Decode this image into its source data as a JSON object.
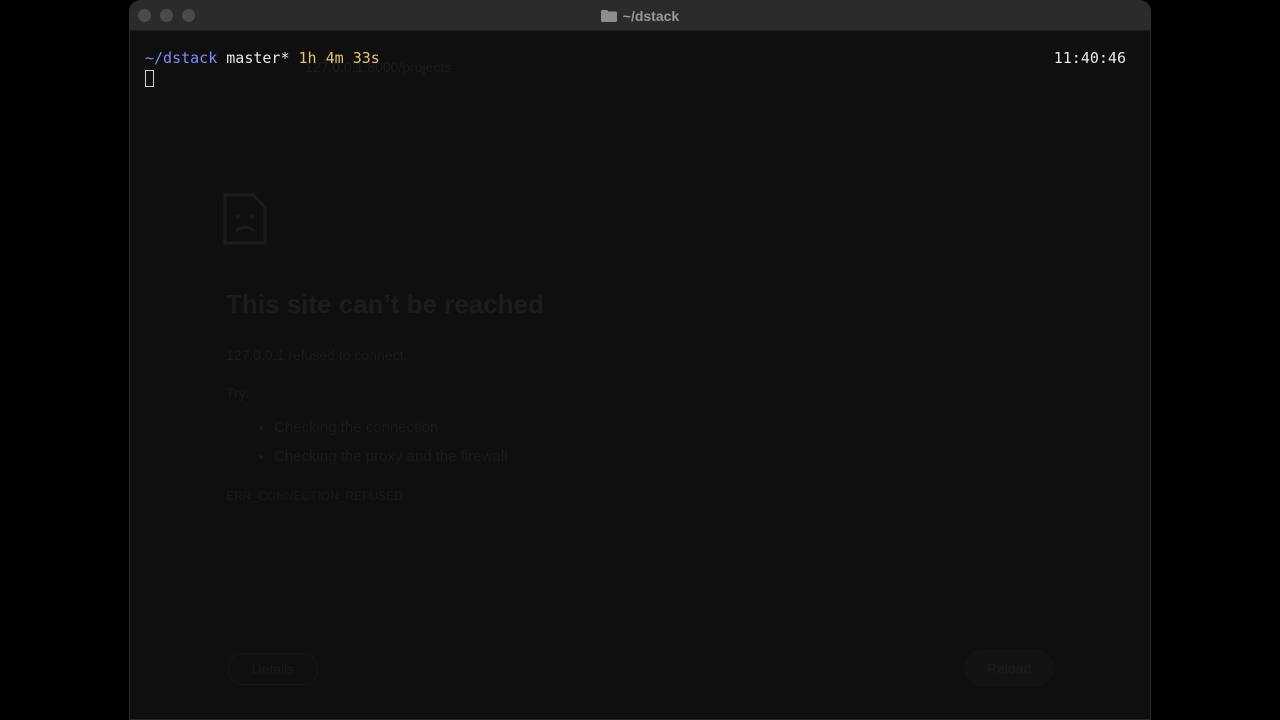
{
  "window": {
    "title": "~/dstack",
    "title_icon": "folder-icon"
  },
  "terminal": {
    "cwd": "~/dstack",
    "branch": "master*",
    "duration": "1h 4m 33s",
    "clock": "11:40:46"
  },
  "ghost_page": {
    "url": "127.0.0.1:8000/projects",
    "heading": "This site can’t be reached",
    "subtitle": "127.0.0.1 refused to connect.",
    "try_label": "Try:",
    "suggestions": [
      "Checking the connection",
      "Checking the proxy and the firewall"
    ],
    "error_code": "ERR_CONNECTION_REFUSED",
    "details_label": "Details",
    "reload_label": "Reload"
  },
  "colors": {
    "cwd": "#7d8bff",
    "duration": "#e8c36a",
    "text": "#e8e8e8",
    "background": "#0f0f10"
  }
}
